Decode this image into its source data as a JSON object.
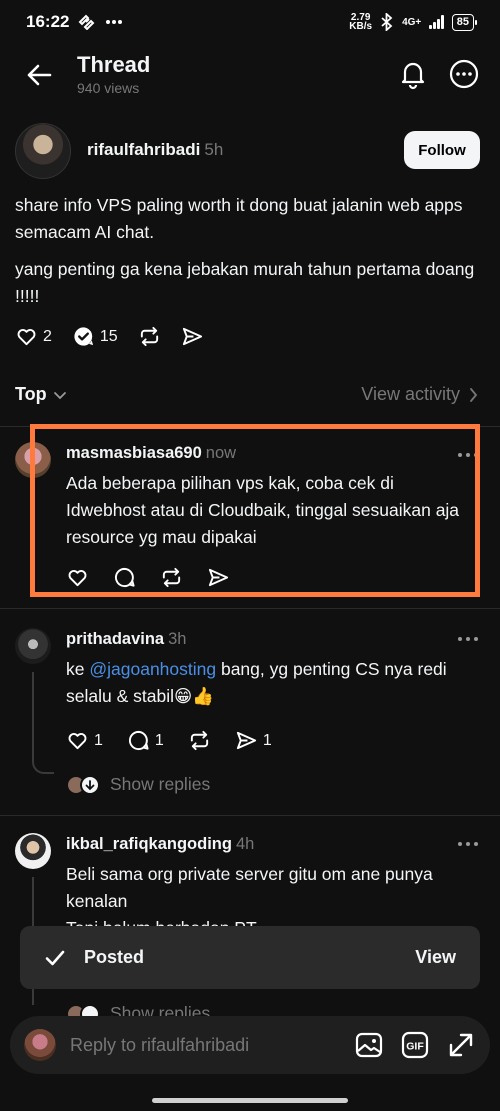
{
  "status_bar": {
    "time": "16:22",
    "net_speed_value": "2.79",
    "net_speed_unit": "KB/s",
    "network": "4G+",
    "battery": "85"
  },
  "header": {
    "title": "Thread",
    "subtitle": "940 views"
  },
  "post": {
    "username": "rifaulfahribadi",
    "time": "5h",
    "follow_label": "Follow",
    "paragraphs": [
      "share info VPS paling worth it dong buat jalanin web apps semacam AI chat.",
      "yang penting ga kena jebakan murah tahun pertama doang !!!!!"
    ],
    "likes": "2",
    "replies": "15"
  },
  "sort": {
    "label": "Top",
    "view_activity": "View activity"
  },
  "replies": [
    {
      "username": "masmasbiasa690",
      "time": "now",
      "text": "Ada beberapa pilihan vps kak, coba cek di Idwebhost atau di Cloudbaik, tinggal sesuaikan aja resource yg mau dipakai"
    },
    {
      "username": "prithadavina",
      "time": "3h",
      "text_before": "ke ",
      "mention": "@jagoanhosting",
      "text_after": " bang, yg penting CS nya redi selalu & stabil😁👍",
      "likes": "1",
      "comments": "1",
      "shares": "1",
      "show_replies": "Show replies"
    },
    {
      "username": "ikbal_rafiqkangoding",
      "time": "4h",
      "text": "Beli sama org private server gitu om ane punya kenalan",
      "text_partial": "Tapi belum berbadan PT",
      "show_replies_partial": "Show replies"
    }
  ],
  "toast": {
    "label": "Posted",
    "action": "View"
  },
  "reply_bar": {
    "placeholder": "Reply to rifaulfahribadi",
    "gif_label": "GIF"
  },
  "colors": {
    "background": "#101010",
    "highlight": "#ff7a3d",
    "mention": "#4a8fe6",
    "muted": "#777777"
  }
}
